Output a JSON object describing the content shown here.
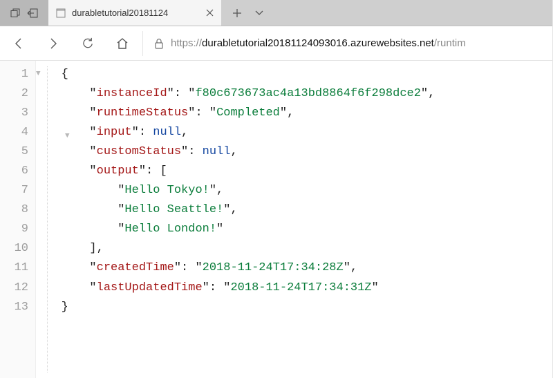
{
  "tab": {
    "title": "durabletutorial20181124"
  },
  "url": {
    "scheme": "https://",
    "host": "durabletutorial20181124093016.azurewebsites.net",
    "path": "/runtim"
  },
  "json": {
    "instanceId": {
      "k": "instanceId",
      "v": "f80c673673ac4a13bd8864f6f298dce2"
    },
    "runtimeStatus": {
      "k": "runtimeStatus",
      "v": "Completed"
    },
    "input": {
      "k": "input",
      "v": "null"
    },
    "customStatus": {
      "k": "customStatus",
      "v": "null"
    },
    "outputKey": "output",
    "output0": "Hello Tokyo!",
    "output1": "Hello Seattle!",
    "output2": "Hello London!",
    "createdTime": {
      "k": "createdTime",
      "v": "2018-11-24T17:34:28Z"
    },
    "lastUpdatedTime": {
      "k": "lastUpdatedTime",
      "v": "2018-11-24T17:34:31Z"
    }
  },
  "lines": [
    "1",
    "2",
    "3",
    "4",
    "5",
    "6",
    "7",
    "8",
    "9",
    "10",
    "11",
    "12",
    "13"
  ]
}
